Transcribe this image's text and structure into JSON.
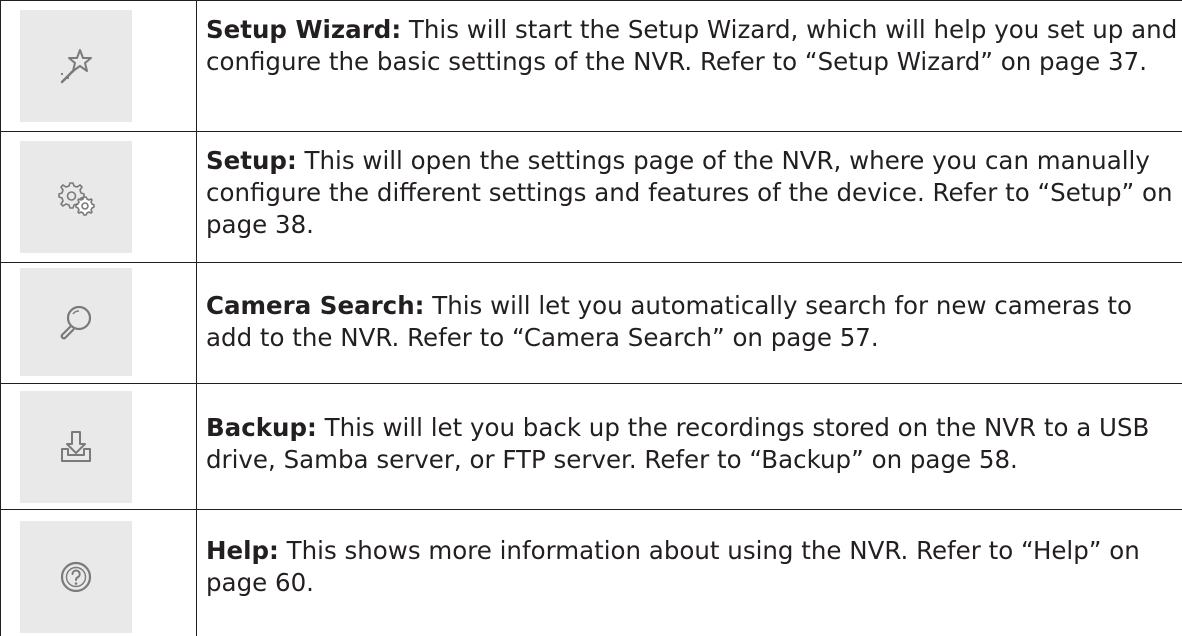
{
  "rows": [
    {
      "icon": "wand-icon",
      "title": "Setup Wizard:",
      "text": " This will start the Setup Wizard, which will help you set up and configure the basic settings of the NVR. Refer to “Setup Wizard” on page 37."
    },
    {
      "icon": "gears-icon",
      "title": "Setup:",
      "text": " This will open the settings page of the NVR, where you can manually configure the different settings and features of the device. Refer to “Setup” on page 38."
    },
    {
      "icon": "search-icon",
      "title": "Camera Search:",
      "text": " This will let you automatically search for new cameras to add to the NVR. Refer to “Camera Search” on page 57."
    },
    {
      "icon": "backup-download-icon",
      "title": "Backup:",
      "text": " This will let you back up the recordings stored on the NVR to a USB drive, Samba server, or FTP server. Refer to “Backup” on page 58."
    },
    {
      "icon": "help-icon",
      "title": "Help:",
      "text": " This shows more information about using the NVR. Refer to “Help” on page 60."
    }
  ]
}
